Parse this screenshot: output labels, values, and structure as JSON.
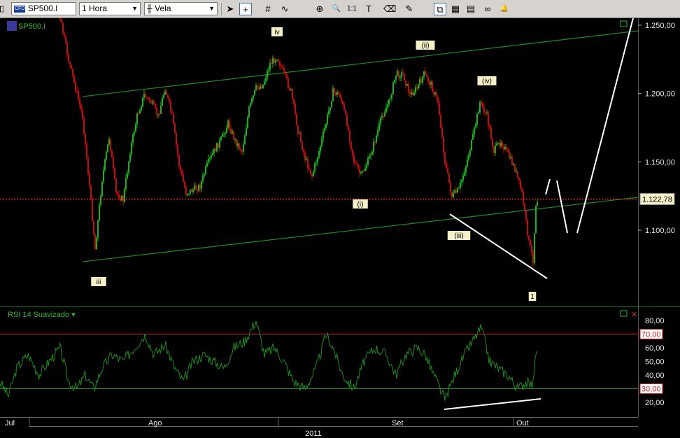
{
  "toolbar": {
    "symbol": "SP500.I",
    "symbol_badge": "CFD",
    "interval": "1 Hora",
    "chart_style": "Vela",
    "tools": [
      {
        "name": "pointer-icon",
        "glyph": "➤"
      },
      {
        "name": "crosshair-icon",
        "glyph": "+"
      },
      {
        "name": "grid-tool-icon",
        "glyph": "#"
      },
      {
        "name": "wave-tool-icon",
        "glyph": "∿"
      },
      {
        "name": "zoom-box-icon",
        "glyph": "⊕"
      },
      {
        "name": "zoom-icon",
        "glyph": "🔍"
      },
      {
        "name": "zoom-reset-icon",
        "glyph": "1:1"
      },
      {
        "name": "text-tool-icon",
        "glyph": "T"
      },
      {
        "name": "eraser-icon",
        "glyph": "⌫"
      },
      {
        "name": "pen-icon",
        "glyph": "✎"
      },
      {
        "name": "magnet-icon",
        "glyph": "⧉"
      },
      {
        "name": "indicator-icon",
        "glyph": "▦"
      },
      {
        "name": "template-icon",
        "glyph": "▤"
      },
      {
        "name": "link-icon",
        "glyph": "∞"
      },
      {
        "name": "alert-bell-icon",
        "glyph": "🔔"
      }
    ]
  },
  "price_panel": {
    "instrument_label": "SP500.I",
    "y_axis_ticks": [
      "1.250,00",
      "1.200,00",
      "1.150,00",
      "1.100,00"
    ],
    "y_axis_values": [
      1250,
      1200,
      1150,
      1100
    ],
    "current_price_label": "1.122,78",
    "current_price": 1122.78,
    "wave_labels": [
      "iv",
      "(ii)",
      "(iv)",
      "(i)",
      "(iii)",
      "iii",
      "1"
    ],
    "colors": {
      "up": "#22dd22",
      "down": "#ee1111",
      "price_line": "#ff3030",
      "channel": "#1e8c1e",
      "annotation": "#ffffff"
    }
  },
  "rsi_panel": {
    "title": "RSI 14 Suavizado",
    "y_axis_ticks": [
      "80,00",
      "60,00",
      "50,00",
      "40,00",
      "20,00"
    ],
    "y_axis_values": [
      80,
      60,
      50,
      40,
      20
    ],
    "level_high_label": "70,00",
    "level_low_label": "30,00",
    "level_high": 70,
    "level_low": 30,
    "colors": {
      "rsi": "#1e8c1e",
      "high_level": "#cc2020",
      "low_level": "#1e8c1e"
    }
  },
  "x_axis": {
    "month_labels": [
      "Jul",
      "Ago",
      "Set",
      "Out"
    ],
    "year_label": "2011"
  }
}
